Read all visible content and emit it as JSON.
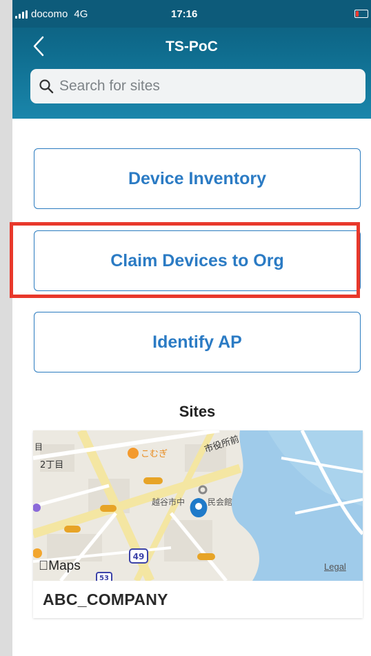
{
  "status_bar": {
    "carrier": "docomo",
    "network": "4G",
    "time": "17:16",
    "battery_color": "#ff3b30"
  },
  "nav": {
    "title": "TS-PoC",
    "back_icon": "chevron-left-icon"
  },
  "search": {
    "placeholder": "Search for sites",
    "value": ""
  },
  "menu": {
    "items": [
      {
        "label": "Device Inventory"
      },
      {
        "label": "Claim Devices to Org",
        "highlighted": true
      },
      {
        "label": "Identify AP"
      }
    ]
  },
  "sites": {
    "title": "Sites",
    "items": [
      {
        "name": "ABC_COMPANY",
        "map": {
          "labels": [
            "目",
            "2丁目",
            "こむぎ",
            "市役所前",
            "越谷市中",
            "民会館"
          ],
          "route_number": "49",
          "route_number_2": "53",
          "maps_brand": "Maps",
          "legal": "Legal"
        }
      }
    ]
  },
  "colors": {
    "accent": "#2b7bc4",
    "nav_top": "#0d5b7a",
    "highlight": "#e8382b"
  }
}
